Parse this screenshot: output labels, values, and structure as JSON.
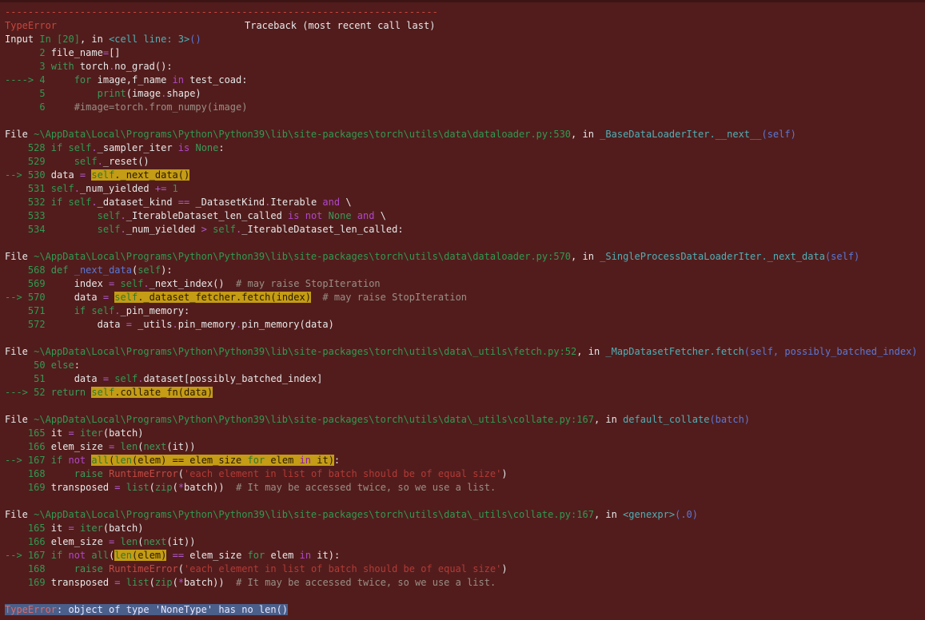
{
  "traceback": {
    "separator": "---------------------------------------------------------------------------",
    "error_name": "TypeError",
    "header_right": "Traceback (most recent call last)",
    "input_prefix": "Input",
    "input_cell": "In [20]",
    "input_mid": ", in",
    "input_loc": "<cell line: 3>",
    "input_paren": "()",
    "frames": [
      {
        "file_prefix": "File",
        "path": "~\\AppData\\Local\\Programs\\Python\\Python39\\lib\\site-packages\\torch\\utils\\data\\dataloader.py:530",
        "in_text": ", in",
        "func": "_BaseDataLoaderIter.__next__",
        "args": "(self)"
      },
      {
        "file_prefix": "File",
        "path": "~\\AppData\\Local\\Programs\\Python\\Python39\\lib\\site-packages\\torch\\utils\\data\\dataloader.py:570",
        "in_text": ", in",
        "func": "_SingleProcessDataLoaderIter._next_data",
        "args": "(self)"
      },
      {
        "file_prefix": "File",
        "path": "~\\AppData\\Local\\Programs\\Python\\Python39\\lib\\site-packages\\torch\\utils\\data\\_utils\\fetch.py:52",
        "in_text": ", in",
        "func": "_MapDatasetFetcher.fetch",
        "args": "(self, possibly_batched_index)"
      },
      {
        "file_prefix": "File",
        "path": "~\\AppData\\Local\\Programs\\Python\\Python39\\lib\\site-packages\\torch\\utils\\data\\_utils\\collate.py:167",
        "in_text": ", in",
        "func": "default_collate",
        "args": "(batch)"
      },
      {
        "file_prefix": "File",
        "path": "~\\AppData\\Local\\Programs\\Python\\Python39\\lib\\site-packages\\torch\\utils\\data\\_utils\\collate.py:167",
        "in_text": ", in",
        "func": "<genexpr>",
        "args": "(.0)"
      }
    ],
    "final_error_name": "TypeError",
    "final_message": ": object of type 'NoneType' has no len()"
  },
  "colors": {
    "background": "#521c1c",
    "highlight": "#c49c15",
    "final_highlight": "#4a5f8a"
  }
}
